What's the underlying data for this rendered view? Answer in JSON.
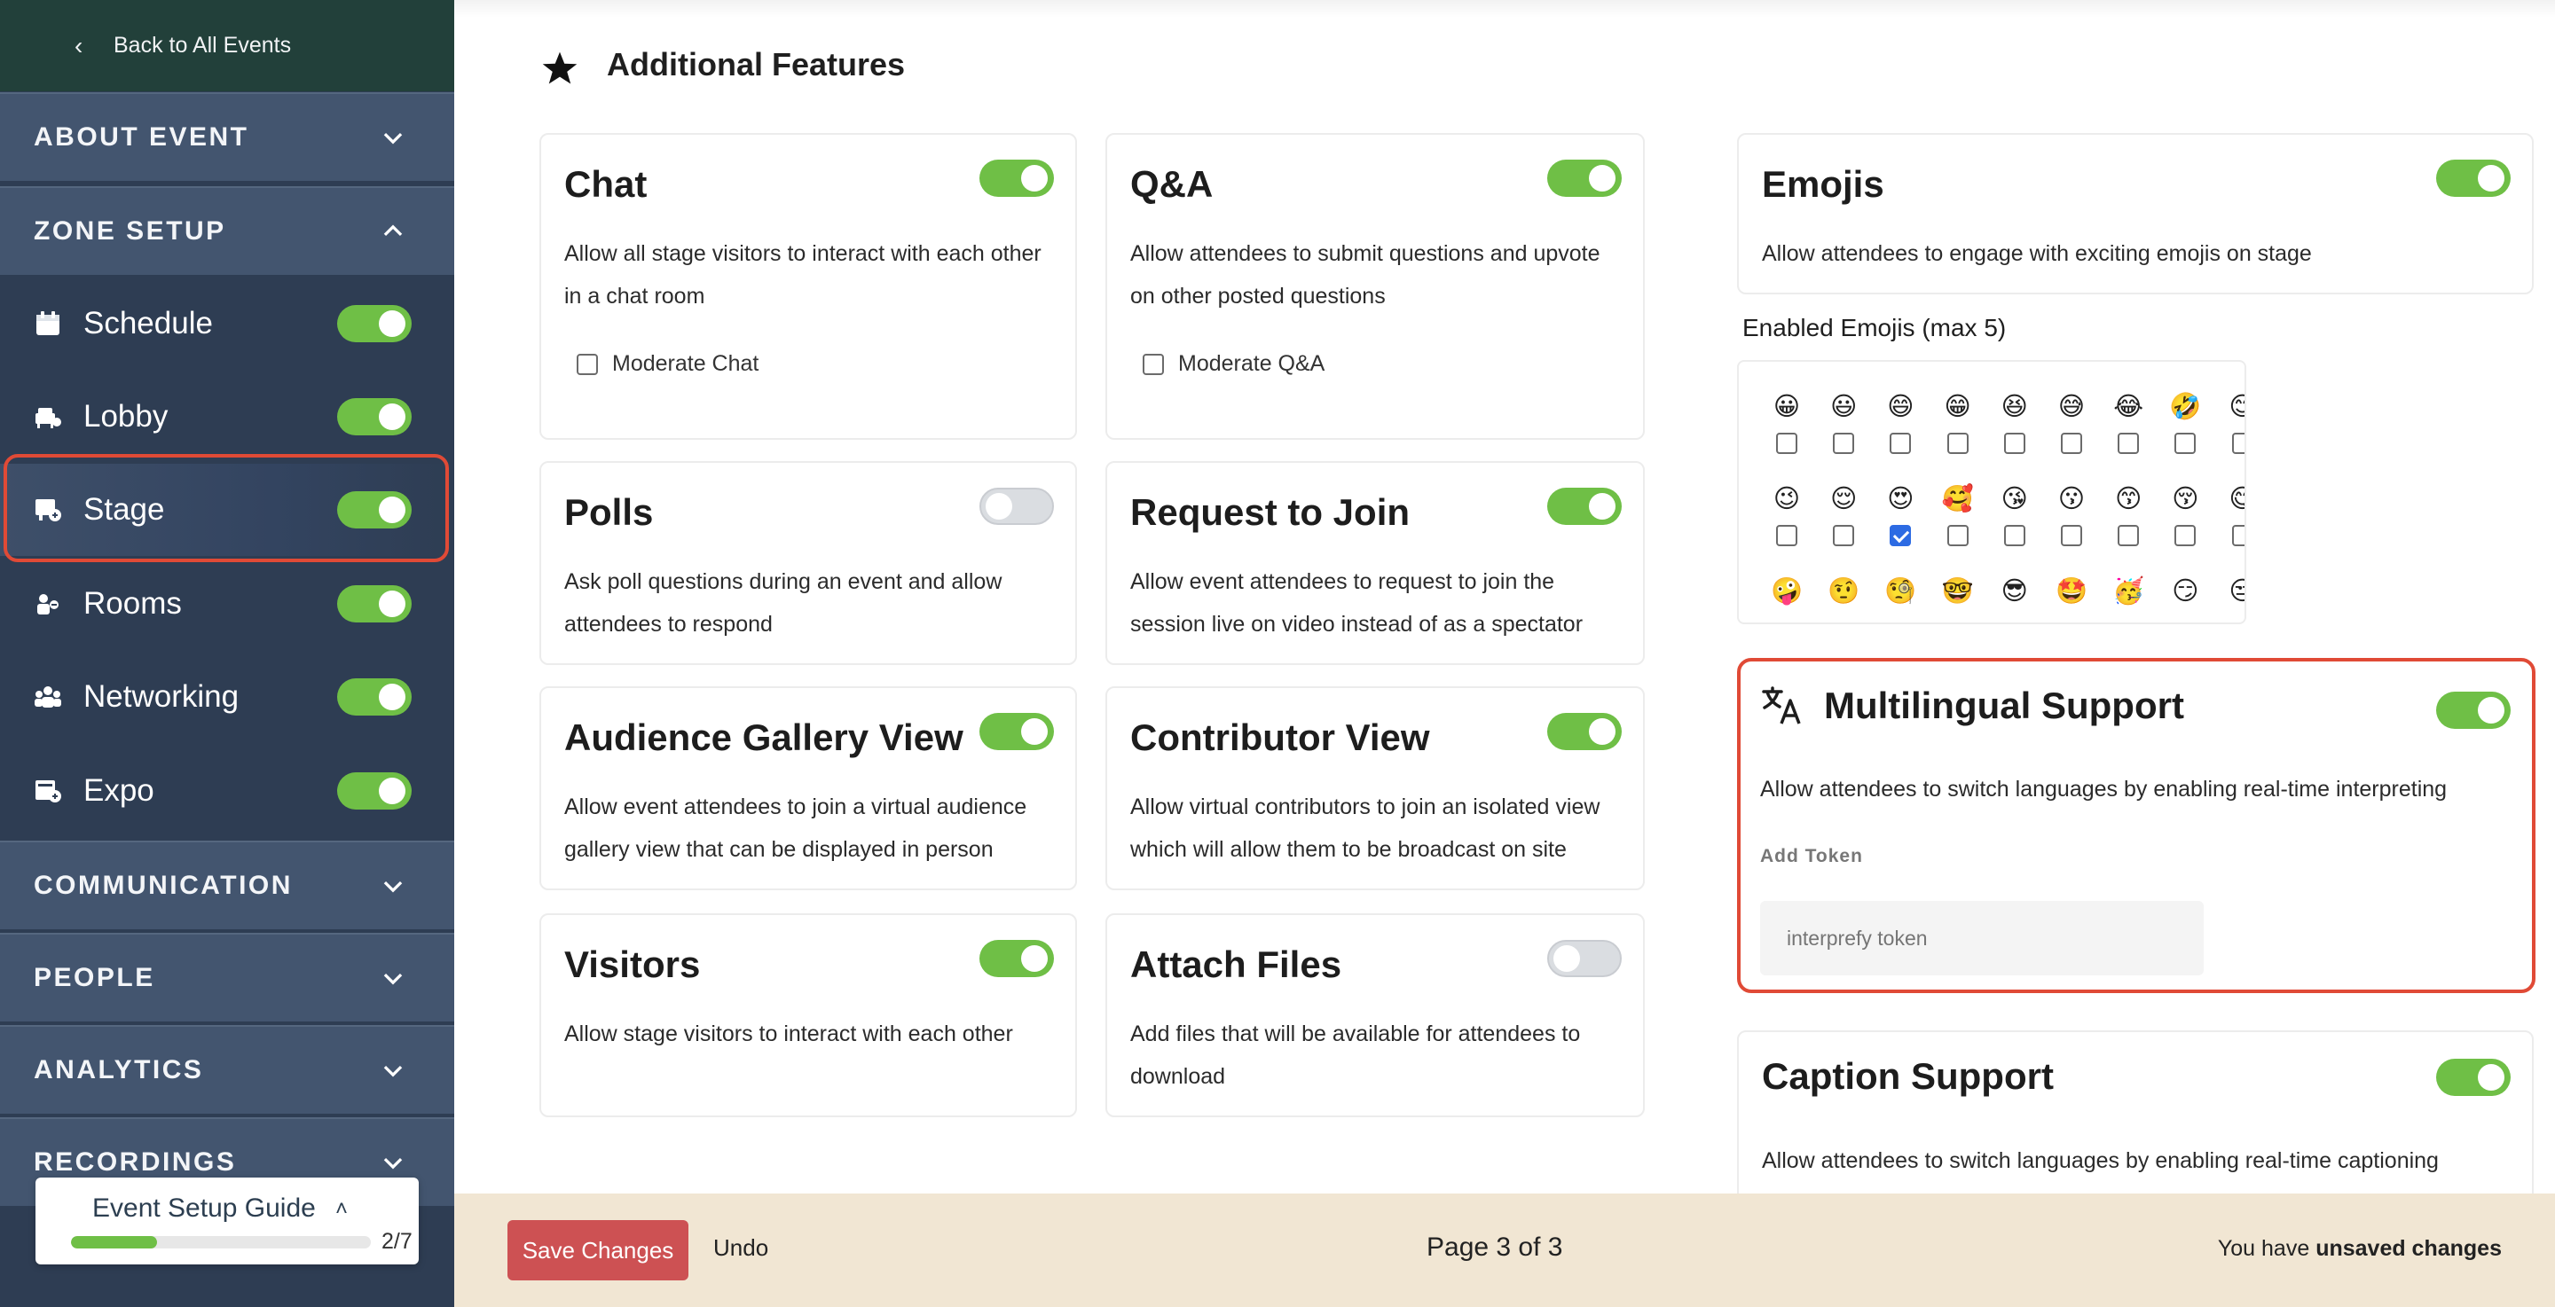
{
  "sidebar": {
    "back_label": "Back to All Events",
    "sections": {
      "about_event": "ABOUT EVENT",
      "zone_setup": "ZONE SETUP",
      "communication": "COMMUNICATION",
      "people": "PEOPLE",
      "analytics": "ANALYTICS",
      "recordings": "RECORDINGS"
    },
    "zone_items": [
      {
        "label": "Schedule",
        "icon": "calendar-icon",
        "enabled": true
      },
      {
        "label": "Lobby",
        "icon": "lobby-icon",
        "enabled": true
      },
      {
        "label": "Stage",
        "icon": "stage-icon",
        "enabled": true,
        "active": true
      },
      {
        "label": "Rooms",
        "icon": "rooms-icon",
        "enabled": true
      },
      {
        "label": "Networking",
        "icon": "networking-icon",
        "enabled": true
      },
      {
        "label": "Expo",
        "icon": "expo-icon",
        "enabled": true
      }
    ]
  },
  "guide": {
    "title": "Event Setup Guide",
    "count": "2/7",
    "progress": 0.2857
  },
  "main": {
    "title": "Additional Features",
    "features": {
      "chat": {
        "title": "Chat",
        "desc": "Allow all stage visitors to interact with each other in a chat room",
        "enabled": true,
        "checkbox": "Moderate Chat"
      },
      "qa": {
        "title": "Q&A",
        "desc": "Allow attendees to submit questions and upvote on other posted questions",
        "enabled": true,
        "checkbox": "Moderate Q&A"
      },
      "polls": {
        "title": "Polls",
        "desc": "Ask poll questions during an event and allow attendees to respond",
        "enabled": false
      },
      "request_join": {
        "title": "Request to Join",
        "desc": "Allow event attendees to request to join the session live on video instead of as a spectator",
        "enabled": true
      },
      "audience_gallery": {
        "title": "Audience Gallery View",
        "desc": "Allow event attendees to join a virtual audience gallery view that can be displayed in person",
        "enabled": true
      },
      "contributor": {
        "title": "Contributor View",
        "desc": "Allow virtual contributors to join an isolated view which will allow them to be broadcast on site",
        "enabled": true
      },
      "visitors": {
        "title": "Visitors",
        "desc": "Allow stage visitors to interact with each other",
        "enabled": true
      },
      "attach_files": {
        "title": "Attach Files",
        "desc": "Add files that will be available for attendees to download",
        "enabled": false
      },
      "emojis": {
        "title": "Emojis",
        "desc": "Allow attendees to engage with exciting emojis on stage",
        "enabled": true
      },
      "multilingual": {
        "title": "Multilingual Support",
        "desc": "Allow attendees to switch languages by enabling real-time interpreting",
        "enabled": true,
        "token_label": "Add Token",
        "token_placeholder": "interprefy token"
      },
      "caption": {
        "title": "Caption Support",
        "desc": "Allow attendees to switch languages by enabling real-time captioning",
        "enabled": true
      }
    },
    "emojis_heading": "Enabled Emojis (max 5)",
    "emoji_rows": [
      {
        "emojis": [
          "😀",
          "😃",
          "😄",
          "😁",
          "😆",
          "😅",
          "😂",
          "🤣",
          "😊",
          "😇",
          "🙂",
          "🙃"
        ],
        "checked": [
          false,
          false,
          false,
          false,
          false,
          false,
          false,
          false,
          false,
          false,
          false,
          false
        ]
      },
      {
        "emojis": [
          "😉",
          "😌",
          "😍",
          "🥰",
          "😘",
          "😗",
          "😙",
          "😚",
          "😋",
          "😛",
          "😝",
          "😜"
        ],
        "checked": [
          false,
          false,
          true,
          false,
          false,
          false,
          false,
          false,
          false,
          false,
          false,
          false
        ]
      },
      {
        "emojis": [
          "🤪",
          "🤨",
          "🧐",
          "🤓",
          "😎",
          "🤩",
          "🥳",
          "😏",
          "😒",
          "😞",
          "😔",
          "😟"
        ],
        "checked": []
      }
    ]
  },
  "footer": {
    "save_label": "Save Changes",
    "undo_label": "Undo",
    "page_indicator": "Page 3 of 3",
    "unsaved_prefix": "You have ",
    "unsaved_bold": "unsaved changes"
  },
  "colors": {
    "accent_green": "#6fbf46",
    "highlight_red": "#e04a36",
    "save_button": "#cd5153",
    "sidebar_bg": "#2e3d53",
    "footer_bg": "#f1e6d3"
  }
}
